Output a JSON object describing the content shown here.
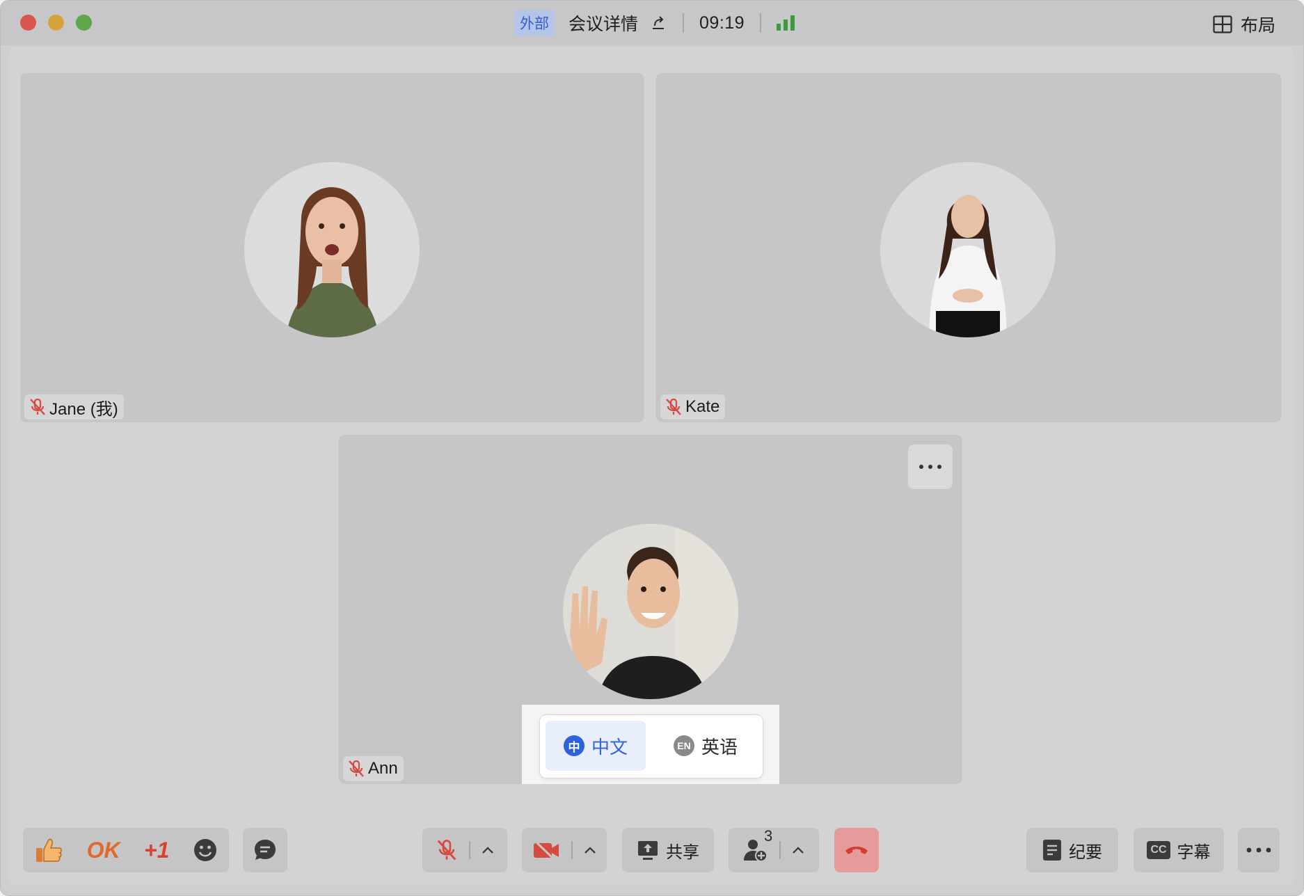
{
  "titlebar": {
    "badge": "外部",
    "meeting_title": "会议详情",
    "clock": "09:19",
    "layout_label": "布局"
  },
  "participants": [
    {
      "name": "Jane (我)"
    },
    {
      "name": "Kate"
    },
    {
      "name": "Ann"
    }
  ],
  "language_menu": {
    "chinese": {
      "icon_char": "中",
      "label": "中文",
      "selected": true
    },
    "english": {
      "icon_char": "EN",
      "label": "英语",
      "selected": false
    }
  },
  "toolbar": {
    "reaction_ok": "OK",
    "reaction_plus_one": "+1",
    "share_label": "共享",
    "participant_count": "3",
    "notes_label": "纪要",
    "captions_label": "字幕",
    "captions_icon_text": "CC"
  },
  "colors": {
    "accent_blue": "#2e63dc",
    "signal_green": "#3d9a3d",
    "mute_red": "#d64a3f",
    "end_call_bg": "#e49b99"
  }
}
